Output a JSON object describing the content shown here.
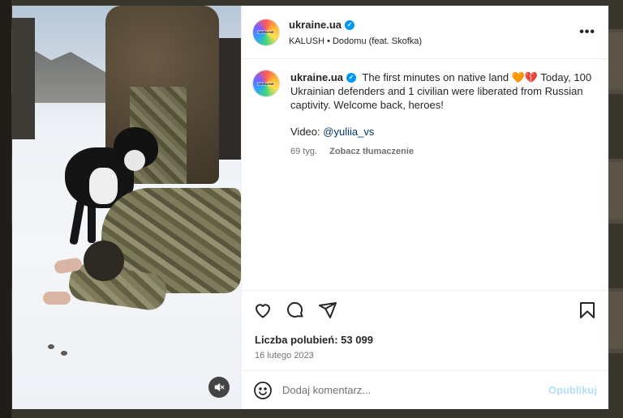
{
  "post": {
    "username": "ukraine.ua",
    "avatar_text": "UKRAINE",
    "audio": "KALUSH • Dodomu (feat. Skofka)",
    "more_label": "•••",
    "caption_text": "The first minutes on native land 🧡💔 Today, 100 Ukrainian defenders and 1 civilian were liberated from Russian captivity. Welcome back, heroes!",
    "video_label": "Video:",
    "video_mention": "@yuliia_vs",
    "time_ago": "69 tyg.",
    "translate_label": "Zobacz tłumaczenie",
    "likes_text": "Liczba polubień: 53 099",
    "date": "16 lutego 2023"
  },
  "comment": {
    "placeholder": "Dodaj komentarz...",
    "publish_label": "Opublikuj"
  },
  "icons": {
    "verified": "verified-badge-icon",
    "like": "heart-icon",
    "comment": "comment-icon",
    "share": "share-icon",
    "save": "bookmark-icon",
    "emoji": "emoji-icon",
    "mute": "muted-speaker-icon"
  },
  "colors": {
    "verified": "#0095f6",
    "publish": "#b2dffc",
    "text": "#262626",
    "muted": "#737373"
  }
}
